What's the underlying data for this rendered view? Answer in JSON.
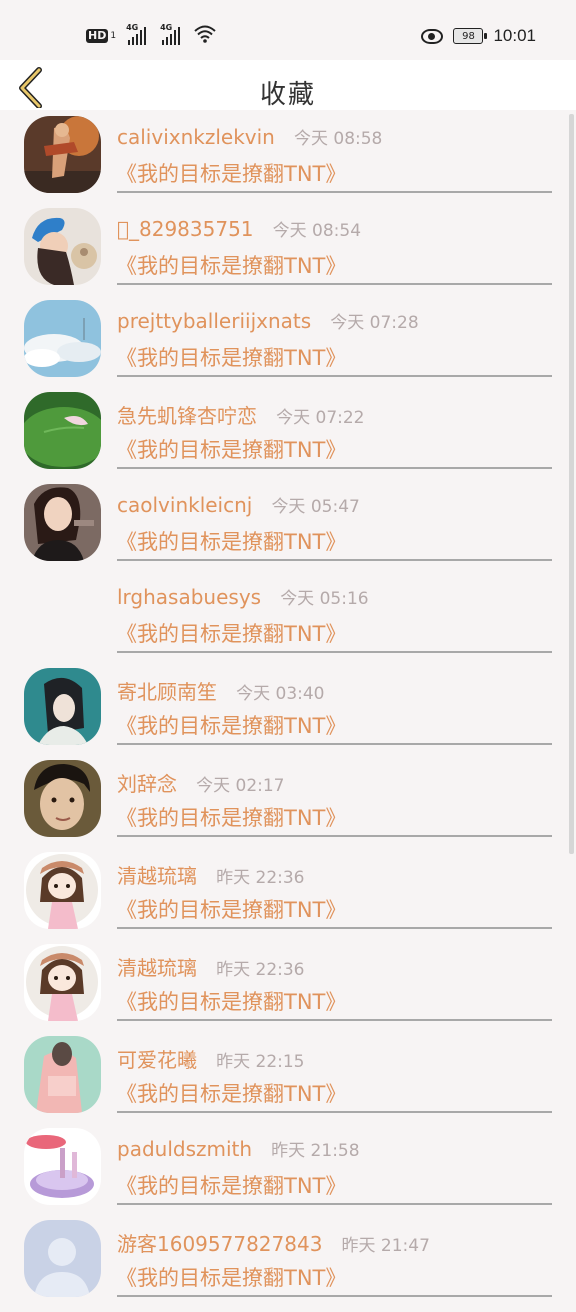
{
  "status_bar": {
    "hd_label": "HD",
    "hd_sub": "1",
    "signal1_label": "4G",
    "signal2_label": "4G",
    "wifi_icon": "wifi-icon",
    "eye_icon": "eye-icon",
    "battery": "98",
    "time": "10:01"
  },
  "header": {
    "title": "收藏",
    "back_icon": "chevron-left-icon",
    "accent_color": "#e0935c"
  },
  "items": [
    {
      "name": "calivixnkzlekvin",
      "time": "今天 08:58",
      "quote": "《我的目标是撩翻TNT》",
      "avatar": "warrior-avatar"
    },
    {
      "name": "\u0000_829835751",
      "time": "今天 08:54",
      "quote": "《我的目标是撩翻TNT》",
      "avatar": "girl-blue-hat-avatar"
    },
    {
      "name": "prejttyballeriijxnats",
      "time": "今天 07:28",
      "quote": "《我的目标是撩翻TNT》",
      "avatar": "sky-clouds-avatar"
    },
    {
      "name": "急先虮锋杏咛恋",
      "time": "今天 07:22",
      "quote": "《我的目标是撩翻TNT》",
      "avatar": "lotus-leaf-avatar"
    },
    {
      "name": "caolvinkleicnj",
      "time": "今天 05:47",
      "quote": "《我的目标是撩翻TNT》",
      "avatar": "woman-photo-avatar"
    },
    {
      "name": "lrghasabuesys",
      "time": "今天 05:16",
      "quote": "《我的目标是撩翻TNT》",
      "avatar": "empty-avatar"
    },
    {
      "name": "寄北顾南笙",
      "time": "今天 03:40",
      "quote": "《我的目标是撩翻TNT》",
      "avatar": "girl-teal-avatar"
    },
    {
      "name": "刘辞念",
      "time": "今天 02:17",
      "quote": "《我的目标是撩翻TNT》",
      "avatar": "boy-photo-avatar"
    },
    {
      "name": "清越琉璃",
      "time": "昨天 22:36",
      "quote": "《我的目标是撩翻TNT》",
      "avatar": "cartoon-girl-avatar"
    },
    {
      "name": "清越琉璃",
      "time": "昨天 22:36",
      "quote": "《我的目标是撩翻TNT》",
      "avatar": "cartoon-girl-avatar"
    },
    {
      "name": "可爱花曦",
      "time": "昨天 22:15",
      "quote": "《我的目标是撩翻TNT》",
      "avatar": "pink-figure-avatar"
    },
    {
      "name": "paduldszmith",
      "time": "昨天 21:58",
      "quote": "《我的目标是撩翻TNT》",
      "avatar": "cosmetics-avatar"
    },
    {
      "name": "游客1609577827843",
      "time": "昨天 21:47",
      "quote": "《我的目标是撩翻TNT》",
      "avatar": "default-user-avatar"
    }
  ]
}
